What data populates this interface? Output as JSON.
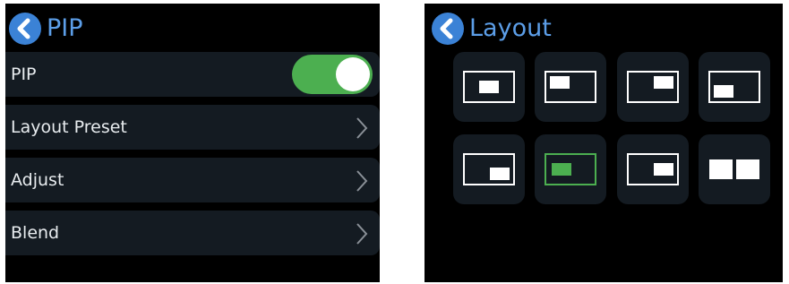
{
  "left": {
    "title": "PIP",
    "back_icon": "chevron-left-icon",
    "items": [
      {
        "label": "PIP",
        "control": "toggle",
        "toggle_on": true
      },
      {
        "label": "Layout Preset",
        "control": "chevron-right-icon"
      },
      {
        "label": "Adjust",
        "control": "chevron-right-icon"
      },
      {
        "label": "Blend",
        "control": "chevron-right-icon"
      }
    ]
  },
  "right": {
    "title": "Layout",
    "back_icon": "chevron-left-icon",
    "presets": [
      {
        "name": "center",
        "selected": false
      },
      {
        "name": "top-left",
        "selected": false
      },
      {
        "name": "top-right",
        "selected": false
      },
      {
        "name": "bottom-left",
        "selected": false
      },
      {
        "name": "bottom-right",
        "selected": false
      },
      {
        "name": "center-selected",
        "selected": true
      },
      {
        "name": "right",
        "selected": false
      },
      {
        "name": "side-by-side",
        "selected": false
      }
    ]
  },
  "colors": {
    "background": "#000000",
    "row_background": "#141b22",
    "accent_blue": "#3b82d6",
    "title_blue": "#5c9ee8",
    "toggle_green": "#4caf50",
    "selected_green": "#4caf50",
    "text": "#e8ecef"
  }
}
